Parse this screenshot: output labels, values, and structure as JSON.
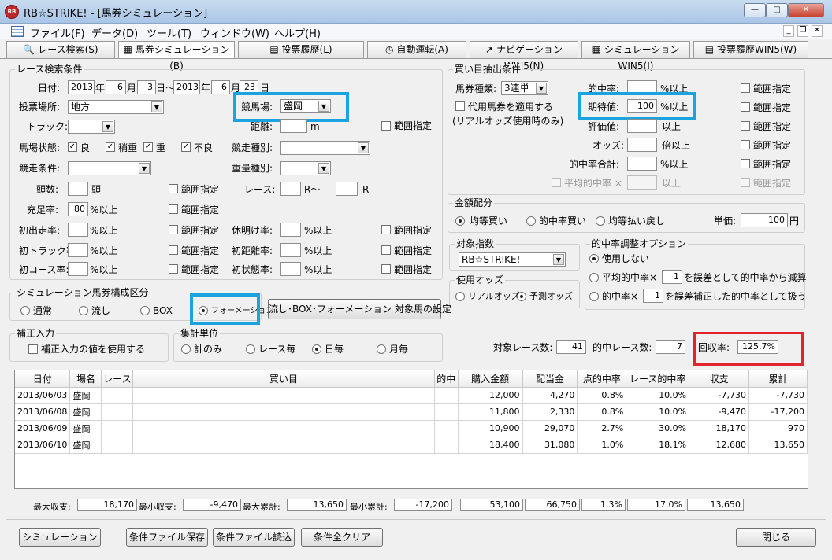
{
  "window": {
    "title": "RB☆STRIKE! - [馬券シミュレーション]",
    "min": "—",
    "max": "□",
    "close": "✕",
    "inner_min": "_",
    "inner_restore": "❐",
    "inner_close": "✕"
  },
  "menu": [
    "ファイル(F)",
    "データ(D)",
    "ツール(T)",
    "ウィンドウ(W)",
    "ヘルプ(H)"
  ],
  "tabs": [
    "レース検索(S)",
    "馬券シミュレーション(B)",
    "投票履歴(L)",
    "自動運転(A)",
    "ナビゲーションWIN5(N)",
    "シミュレーションWIN5(I)",
    "投票履歴WIN5(W)"
  ],
  "race": {
    "group": "レース検索条件",
    "date_label": "日付:",
    "from_year": "2013",
    "year_unit": "年",
    "from_month": "6",
    "month_unit": "月",
    "from_day": "3",
    "day_sep": "日～",
    "to_year": "2013",
    "to_month": "6",
    "to_day": "23",
    "day_unit": "日",
    "venue_label": "投票場所:",
    "venue": "地方",
    "course_label": "競馬場:",
    "course": "盛岡",
    "track_label": "トラック:",
    "track": "",
    "distance_label": "距離:",
    "distance": "",
    "distance_unit": "m",
    "range_label": "範囲指定",
    "condition_label": "馬場状態:",
    "cond_good": "良",
    "cond_yielding": "稍重",
    "cond_heavy": "重",
    "cond_bad": "不良",
    "race_kind_label": "競走種別:",
    "race_kind": "",
    "race_cond_label": "競走条件:",
    "race_cond": "",
    "weight_label": "重量種別:",
    "weight": "",
    "heads_label": "頭数:",
    "heads": "",
    "heads_unit": "頭",
    "races_label": "レース:",
    "race_from": "",
    "race_mid": "R～",
    "race_to": "",
    "race_unit": "R",
    "fill_label": "充足率:",
    "fill": "80",
    "pct_over": "%以上",
    "first_label": "初出走率:",
    "first": "",
    "rest_label": "休明け率:",
    "rest": "",
    "ftrack_label": "初トラック率:",
    "ftrack": "",
    "fdist_label": "初距離率:",
    "fdist": "",
    "fcourse_label": "初コース率:",
    "fcourse": "",
    "fform_label": "初状態率:",
    "fform": ""
  },
  "buy": {
    "group": "買い目抽出条件",
    "type_label": "馬券種類:",
    "type": "3連単",
    "hit_label": "的中率:",
    "hit": "",
    "pct_over": "%以上",
    "sub_label": "代用馬券を適用する",
    "sub_note": "(リアルオッズ使用時のみ)",
    "exp_label": "期待値:",
    "exp": "100",
    "eval_label": "評価値:",
    "eval": "",
    "over": "以上",
    "odds_label": "オッズ:",
    "odds": "",
    "times_over": "倍以上",
    "hitsum_label": "的中率合計:",
    "hitsum": "",
    "avg_label": "平均的中率 ×",
    "avg": "",
    "range_label": "範囲指定"
  },
  "money": {
    "group": "金額配分",
    "even": "均等買い",
    "byhit": "的中率買い",
    "evenret": "均等払い戻し",
    "unit_label": "単価:",
    "unit": "100",
    "unit_suffix": "円"
  },
  "index": {
    "group": "対象指数",
    "value": "RB☆STRIKE!"
  },
  "odds": {
    "group": "使用オッズ",
    "real": "リアルオッズ",
    "pred": "予測オッズ"
  },
  "adjust": {
    "group": "的中率調整オプション",
    "none": "使用しない",
    "avg_pre": "平均的中率×",
    "avg_val": "1",
    "avg_post": "を誤差として的中率から減算",
    "hit_pre": "的中率×",
    "hit_val": "1",
    "hit_post": "を誤差補正した的中率として扱う"
  },
  "sim": {
    "group": "シミュレーション馬券構成区分",
    "normal": "通常",
    "nagashi": "流し",
    "box": "BOX",
    "formation": "フォーメーション",
    "target_btn": "流し･BOX･フォーメーション 対象馬の設定"
  },
  "corr": {
    "group": "補正入力",
    "use": "補正入力の値を使用する"
  },
  "agg": {
    "group": "集計単位",
    "total": "計のみ",
    "per_race": "レース毎",
    "daily": "日毎",
    "monthly": "月毎"
  },
  "stats": {
    "target_label": "対象レース数:",
    "target": "41",
    "hit_label": "的中レース数:",
    "hit": "7",
    "recovery_label": "回収率:",
    "recovery": "125.7%"
  },
  "table": {
    "headers": [
      "日付",
      "場名",
      "レース",
      "買い目",
      "的中",
      "購入金額",
      "配当金",
      "点的中率",
      "レース的中率",
      "収支",
      "累計"
    ],
    "rows": [
      [
        "2013/06/03",
        "盛岡",
        "",
        "",
        "",
        "12,000",
        "4,270",
        "0.8%",
        "10.0%",
        "-7,730",
        "-7,730"
      ],
      [
        "2013/06/08",
        "盛岡",
        "",
        "",
        "",
        "11,800",
        "2,330",
        "0.8%",
        "10.0%",
        "-9,470",
        "-17,200"
      ],
      [
        "2013/06/09",
        "盛岡",
        "",
        "",
        "",
        "10,900",
        "29,070",
        "2.7%",
        "30.0%",
        "18,170",
        "970"
      ],
      [
        "2013/06/10",
        "盛岡",
        "",
        "",
        "",
        "18,400",
        "31,080",
        "1.0%",
        "18.1%",
        "12,680",
        "13,650"
      ]
    ]
  },
  "summary": {
    "max_inc_label": "最大収支:",
    "max_inc": "18,170",
    "min_inc_label": "最小収支:",
    "min_inc": "-9,470",
    "max_cum_label": "最大累計:",
    "max_cum": "13,650",
    "min_cum_label": "最小累計:",
    "min_cum": "-17,200",
    "buy_total": "53,100",
    "pay_total": "66,750",
    "pt_rate": "1.3%",
    "race_rate": "17.0%",
    "income": "13,650"
  },
  "buttons": {
    "simulate": "シミュレーション",
    "save": "条件ファイル保存",
    "load": "条件ファイル読込",
    "clear": "条件全クリア",
    "close": "閉じる"
  }
}
